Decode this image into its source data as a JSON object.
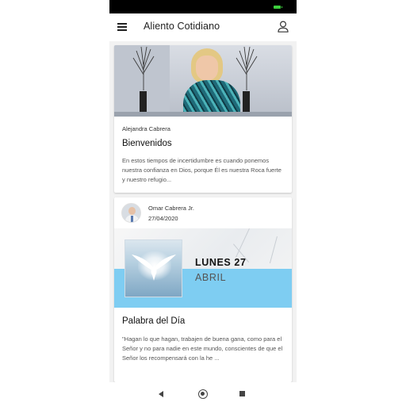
{
  "app": {
    "title": "Aliento Cotidiano"
  },
  "colors": {
    "accent_stripe": "#7ecdf2",
    "status_bar": "#000000",
    "battery": "#3ecf3e"
  },
  "icons": {
    "menu": "hamburger-menu-icon",
    "account": "user-icon",
    "nav_back": "back-triangle-icon",
    "nav_home": "home-circle-icon",
    "nav_recents": "recents-square-icon"
  },
  "feed": {
    "post1": {
      "author": "Alejandra Cabrera",
      "title": "Bienvenidos",
      "excerpt": "En estos tiempos de incertidumbre es cuando ponemos nuestra confianza en Dios, porque Él es nuestra Roca fuerte y nuestro refugio..."
    },
    "post2": {
      "author": "Omar Cabrera Jr.",
      "date": "27/04/2020",
      "banner_day": "LUNES 27",
      "banner_month": "ABRIL",
      "title": "Palabra del Día",
      "excerpt": "\"Hagan lo que hagan, trabajen de buena gana, como para el Señor y no para nadie en este mundo, conscientes de que el Señor los recompensará con la he ..."
    }
  }
}
